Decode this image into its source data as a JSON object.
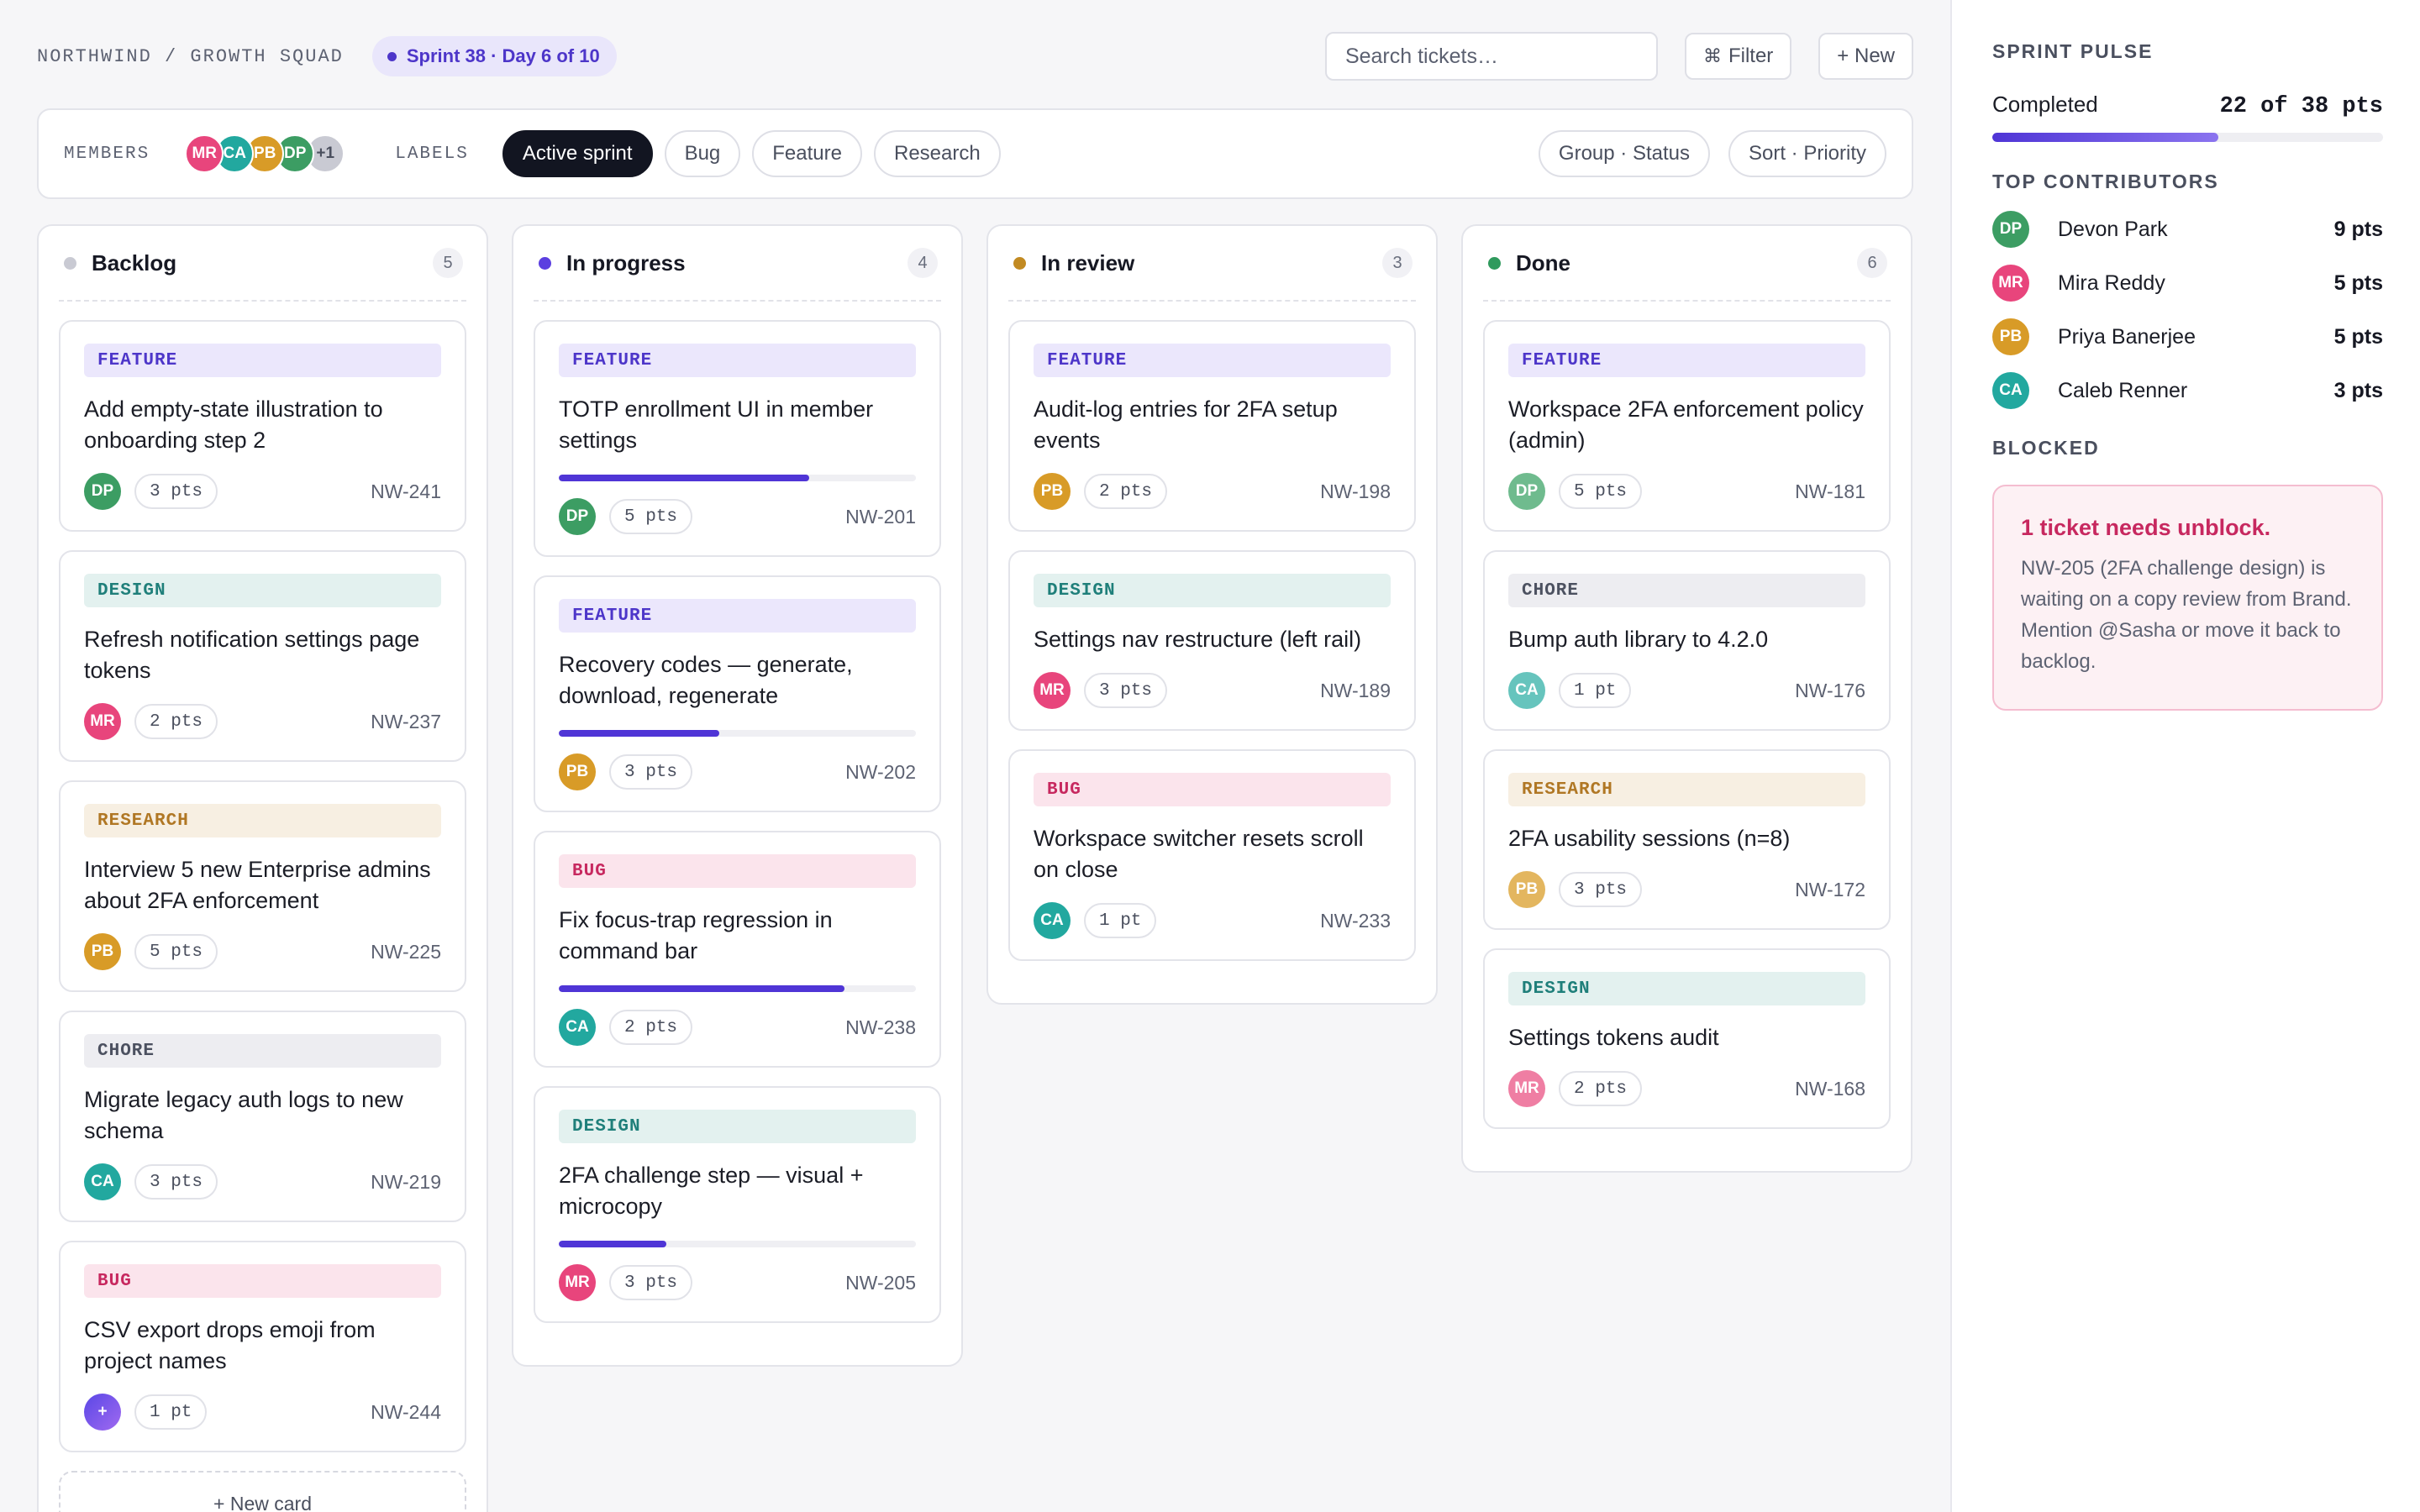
{
  "header": {
    "breadcrumb": "NORTHWIND / GROWTH SQUAD",
    "sprint_label": "Sprint 38 · Day 6 of 10",
    "search_placeholder": "Search tickets…",
    "filter_label": "Filter",
    "filter_icon": "⌘",
    "new_label": "+ New"
  },
  "filters": {
    "members_label": "MEMBERS",
    "members": [
      {
        "initials": "MR",
        "color": "#e8457c"
      },
      {
        "initials": "CA",
        "color": "#22a89f"
      },
      {
        "initials": "PB",
        "color": "#d89b27"
      },
      {
        "initials": "DP",
        "color": "#3c9d63"
      }
    ],
    "members_more": "+1",
    "labels_label": "LABELS",
    "labels": [
      "Active sprint",
      "Bug",
      "Feature",
      "Research"
    ],
    "group": "Group · Status",
    "sort": "Sort · Priority"
  },
  "columns": [
    {
      "title": "Backlog",
      "count": "5",
      "dot_color": "#c9cad3",
      "cards": [
        {
          "tag": "FEATURE",
          "kind": "feature",
          "title": "Add empty-state illustration to onboarding step 2",
          "avatar": "DP",
          "avatar_color": "#3c9d63",
          "points": "3 pts",
          "id": "NW-241"
        },
        {
          "tag": "DESIGN",
          "kind": "design",
          "title": "Refresh notification settings page tokens",
          "avatar": "MR",
          "avatar_color": "#e8457c",
          "points": "2 pts",
          "id": "NW-237"
        },
        {
          "tag": "RESEARCH",
          "kind": "research",
          "title": "Interview 5 new Enterprise admins about 2FA enforcement",
          "avatar": "PB",
          "avatar_color": "#d89b27",
          "points": "5 pts",
          "id": "NW-225"
        },
        {
          "tag": "CHORE",
          "kind": "chore",
          "title": "Migrate legacy auth logs to new schema",
          "avatar": "CA",
          "avatar_color": "#22a89f",
          "points": "3 pts",
          "id": "NW-219"
        },
        {
          "tag": "BUG",
          "kind": "bug",
          "title": "CSV export drops emoji from project names",
          "avatar": "+",
          "avatar_color": "#7a4ee8",
          "points": "1 pt",
          "id": "NW-244"
        }
      ],
      "new_card": "+ New card"
    },
    {
      "title": "In progress",
      "count": "4",
      "dot_color": "#5b3fe0",
      "cards": [
        {
          "tag": "FEATURE",
          "kind": "feature",
          "title": "TOTP enrollment UI in member settings",
          "progress": 0.7,
          "avatar": "DP",
          "avatar_color": "#3c9d63",
          "points": "5 pts",
          "id": "NW-201"
        },
        {
          "tag": "FEATURE",
          "kind": "feature",
          "title": "Recovery codes — generate, download, regenerate",
          "progress": 0.45,
          "avatar": "PB",
          "avatar_color": "#d89b27",
          "points": "3 pts",
          "id": "NW-202"
        },
        {
          "tag": "BUG",
          "kind": "bug",
          "title": "Fix focus-trap regression in command bar",
          "progress": 0.8,
          "avatar": "CA",
          "avatar_color": "#22a89f",
          "points": "2 pts",
          "id": "NW-238"
        },
        {
          "tag": "DESIGN",
          "kind": "design",
          "title": "2FA challenge step — visual + microcopy",
          "progress": 0.3,
          "avatar": "MR",
          "avatar_color": "#e8457c",
          "points": "3 pts",
          "id": "NW-205"
        }
      ]
    },
    {
      "title": "In review",
      "count": "3",
      "dot_color": "#c28a22",
      "cards": [
        {
          "tag": "FEATURE",
          "kind": "feature",
          "title": "Audit-log entries for 2FA setup events",
          "avatar": "PB",
          "avatar_color": "#d89b27",
          "points": "2 pts",
          "id": "NW-198"
        },
        {
          "tag": "DESIGN",
          "kind": "design",
          "title": "Settings nav restructure (left rail)",
          "avatar": "MR",
          "avatar_color": "#e8457c",
          "points": "3 pts",
          "id": "NW-189"
        },
        {
          "tag": "BUG",
          "kind": "bug",
          "title": "Workspace switcher resets scroll on close",
          "avatar": "CA",
          "avatar_color": "#22a89f",
          "points": "1 pt",
          "id": "NW-233"
        }
      ]
    },
    {
      "title": "Done",
      "count": "6",
      "dot_color": "#2f9a5d",
      "cards": [
        {
          "tag": "FEATURE",
          "kind": "feature",
          "title": "Workspace 2FA enforcement policy (admin)",
          "avatar": "DP",
          "avatar_color": "#6fbb8e",
          "points": "5 pts",
          "id": "NW-181"
        },
        {
          "tag": "CHORE",
          "kind": "chore",
          "title": "Bump auth library to 4.2.0",
          "avatar": "CA",
          "avatar_color": "#66c4bd",
          "points": "1 pt",
          "id": "NW-176"
        },
        {
          "tag": "RESEARCH",
          "kind": "research",
          "title": "2FA usability sessions (n=8)",
          "avatar": "PB",
          "avatar_color": "#e3b65f",
          "points": "3 pts",
          "id": "NW-172"
        },
        {
          "tag": "DESIGN",
          "kind": "design",
          "title": "Settings tokens audit",
          "avatar": "MR",
          "avatar_color": "#ef7ea3",
          "points": "2 pts",
          "id": "NW-168"
        }
      ]
    }
  ],
  "sidebar": {
    "pulse_heading": "SPRINT PULSE",
    "completed_label": "Completed",
    "completed_value": "22 of 38 pts",
    "completed_fraction": 0.579,
    "contributors_heading": "TOP CONTRIBUTORS",
    "contributors": [
      {
        "initials": "DP",
        "name": "Devon Park",
        "points": "9 pts",
        "color": "#3c9d63"
      },
      {
        "initials": "MR",
        "name": "Mira Reddy",
        "points": "5 pts",
        "color": "#e8457c"
      },
      {
        "initials": "PB",
        "name": "Priya Banerjee",
        "points": "5 pts",
        "color": "#d89b27"
      },
      {
        "initials": "CA",
        "name": "Caleb Renner",
        "points": "3 pts",
        "color": "#22a89f"
      }
    ],
    "blocked_heading": "BLOCKED",
    "blocked_title": "1 ticket needs unblock.",
    "blocked_body": "NW-205 (2FA challenge design) is waiting on a copy review from Brand. Mention @Sasha or move it back to backlog."
  }
}
